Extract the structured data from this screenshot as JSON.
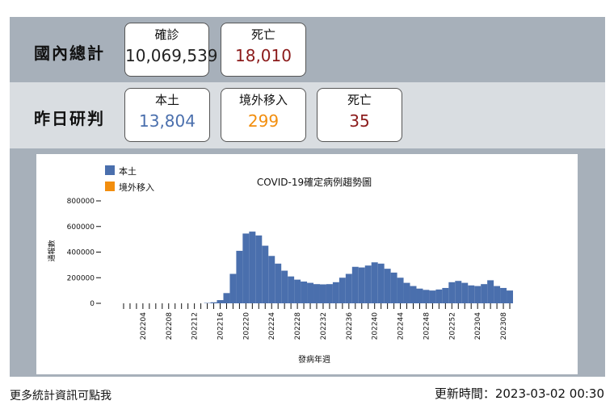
{
  "total": {
    "label": "國內總計",
    "confirmed_title": "確診",
    "confirmed_value": "10,069,539",
    "deaths_title": "死亡",
    "deaths_value": "18,010"
  },
  "yesterday": {
    "label": "昨日研判",
    "local_title": "本土",
    "local_value": "13,804",
    "imported_title": "境外移入",
    "imported_value": "299",
    "deaths_title": "死亡",
    "deaths_value": "35"
  },
  "colors": {
    "local": "#4a6fad",
    "imported": "#f28e0e",
    "deaths": "#8b1a1a",
    "frame": "#a7b0ba"
  },
  "footer": {
    "more_link": "更多統計資訊可點我",
    "updated": "更新時間：2023-03-02 00:30"
  },
  "chart_data": {
    "type": "bar",
    "title": "COVID-19確定病例趨勢圖",
    "xlabel": "發病年週",
    "ylabel": "通報數",
    "ylim": [
      0,
      800000
    ],
    "yticks": [
      0,
      200000,
      400000,
      600000,
      800000
    ],
    "legend_position": "top-left",
    "categories": [
      "202201",
      "202202",
      "202203",
      "202204",
      "202205",
      "202206",
      "202207",
      "202208",
      "202209",
      "202210",
      "202211",
      "202212",
      "202213",
      "202214",
      "202215",
      "202216",
      "202217",
      "202218",
      "202219",
      "202220",
      "202221",
      "202222",
      "202223",
      "202224",
      "202225",
      "202226",
      "202227",
      "202228",
      "202229",
      "202230",
      "202231",
      "202232",
      "202233",
      "202234",
      "202235",
      "202236",
      "202237",
      "202238",
      "202239",
      "202240",
      "202241",
      "202242",
      "202243",
      "202244",
      "202245",
      "202246",
      "202247",
      "202248",
      "202249",
      "202250",
      "202251",
      "202252",
      "202301",
      "202302",
      "202303",
      "202304",
      "202305",
      "202306",
      "202307",
      "202308",
      "202309"
    ],
    "tick_labels": [
      "202204",
      "202208",
      "202212",
      "202216",
      "202220",
      "202224",
      "202228",
      "202232",
      "202236",
      "202240",
      "202244",
      "202248",
      "202252",
      "202304",
      "202308"
    ],
    "series": [
      {
        "name": "本土",
        "values": [
          0,
          0,
          0,
          0,
          0,
          0,
          0,
          0,
          0,
          0,
          0,
          0,
          0,
          3000,
          8000,
          25000,
          80000,
          230000,
          410000,
          545000,
          560000,
          530000,
          450000,
          370000,
          310000,
          255000,
          210000,
          185000,
          170000,
          160000,
          150000,
          148000,
          150000,
          165000,
          200000,
          230000,
          285000,
          280000,
          295000,
          320000,
          310000,
          270000,
          240000,
          200000,
          160000,
          135000,
          115000,
          105000,
          100000,
          108000,
          120000,
          165000,
          175000,
          160000,
          140000,
          135000,
          150000,
          180000,
          135000,
          120000,
          100000,
          50000
        ]
      },
      {
        "name": "境外移入",
        "values": [
          0,
          0,
          0,
          0,
          0,
          0,
          0,
          0,
          0,
          0,
          0,
          0,
          0,
          0,
          0,
          0,
          0,
          0,
          0,
          0,
          0,
          0,
          0,
          0,
          0,
          0,
          0,
          0,
          0,
          0,
          0,
          0,
          0,
          0,
          0,
          0,
          0,
          0,
          0,
          0,
          0,
          0,
          0,
          0,
          0,
          0,
          0,
          0,
          0,
          0,
          0,
          0,
          0,
          0,
          0,
          0,
          0,
          0,
          0,
          0,
          0,
          0
        ]
      }
    ]
  }
}
